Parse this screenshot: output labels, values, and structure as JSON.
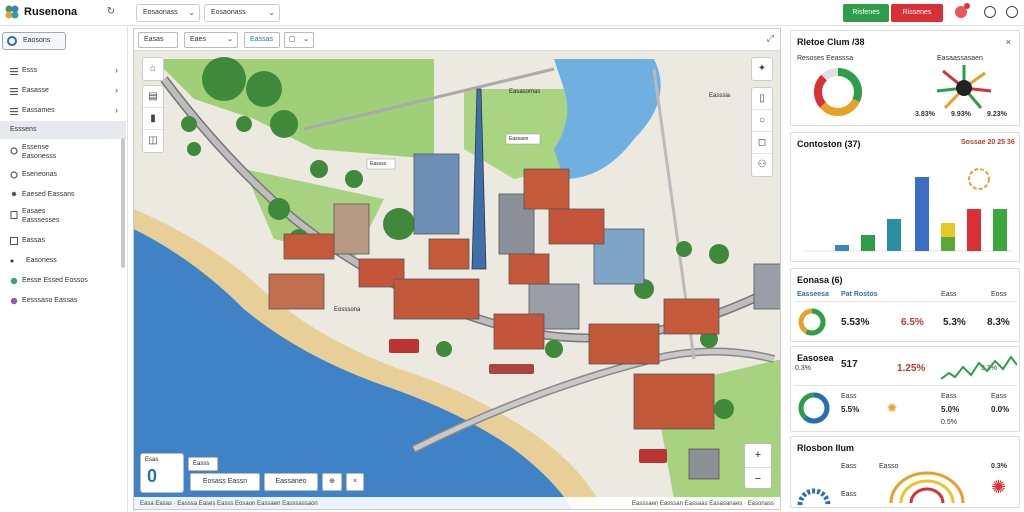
{
  "app": {
    "title": "Rusenona"
  },
  "topbar": {
    "select1": "Eosaonass",
    "select2": "Eosaonass",
    "green_btn": "Risfenes",
    "red_btn": "Rissenes"
  },
  "sidebar": {
    "top_label": "Eaosons",
    "items": [
      {
        "label": "Esss",
        "chev": "›"
      },
      {
        "label": "Easasse",
        "chev": "›"
      },
      {
        "label": "Eassames",
        "chev": "›"
      },
      {
        "label": "Esssens",
        "chev": ""
      },
      {
        "label": "Essense\nEasonesss",
        "chev": ""
      },
      {
        "label": "Eseneonas",
        "chev": ""
      },
      {
        "label": "Eaesed Eassans",
        "chev": ""
      },
      {
        "label": "Easaes\nEasssesses",
        "chev": ""
      },
      {
        "label": "Eassas",
        "chev": ""
      },
      {
        "label": "Easoness",
        "chev": ""
      },
      {
        "label": "Eesse Essed Eossos",
        "chev": ""
      },
      {
        "label": "Eesssaso Eassas",
        "chev": ""
      }
    ]
  },
  "map": {
    "tab1": "Easas",
    "tab2": "Eaes",
    "tab3": "Eassas",
    "labels": [
      "Easasomas",
      "Easssia",
      "Eassss",
      "Eassaon",
      "Eosssona"
    ],
    "bottom_big": "0",
    "bottom_small": "Esas",
    "bottom_tab": "Easss",
    "btn1": "Eosass Eassn",
    "btn2": "Eassaneo",
    "attribution_left": "Easa Easas · Easssa Eases Easss Eosaon Eassaen Easssassaon",
    "attribution_right": "Easssaen Easssan Eassaas Easasanaes · Easonass"
  },
  "panels": {
    "p1": {
      "title": "Rletoe Clum /38",
      "sub1": "Resoses Eeasssa",
      "sub2": "Easaassasaen",
      "vals": [
        "3.83%",
        "9.93%",
        "9.23%"
      ]
    },
    "p2": {
      "title": "Contoston (37)",
      "right": "Sossae 20 25 36"
    },
    "p3": {
      "title": "Eonasa (6)",
      "cols": [
        "Easseesa",
        "Pat Rostos",
        "Eass",
        "Eoss"
      ],
      "vals": [
        "5.53%",
        "6.5%",
        "5.3%",
        "8.3%"
      ]
    },
    "p4": {
      "title": "Easosea",
      "v1": "517",
      "v2": "1.25%",
      "v3": "0.3%",
      "v4": "3.3%",
      "rows": [
        "Eass",
        "Eass",
        "Eass"
      ],
      "vals": [
        "5.5%",
        "5.0%",
        "0.0%",
        "0.5%"
      ]
    },
    "p5": {
      "title": "Rlosbon Ilum",
      "vals": [
        "Eass",
        "Easso",
        "Eass",
        "0.3%"
      ]
    }
  },
  "colors": {
    "accent": "#2a6fb5",
    "green": "#2e9e4a",
    "red": "#d93035",
    "water": "#3f82c6",
    "land": "#e9e6de"
  }
}
